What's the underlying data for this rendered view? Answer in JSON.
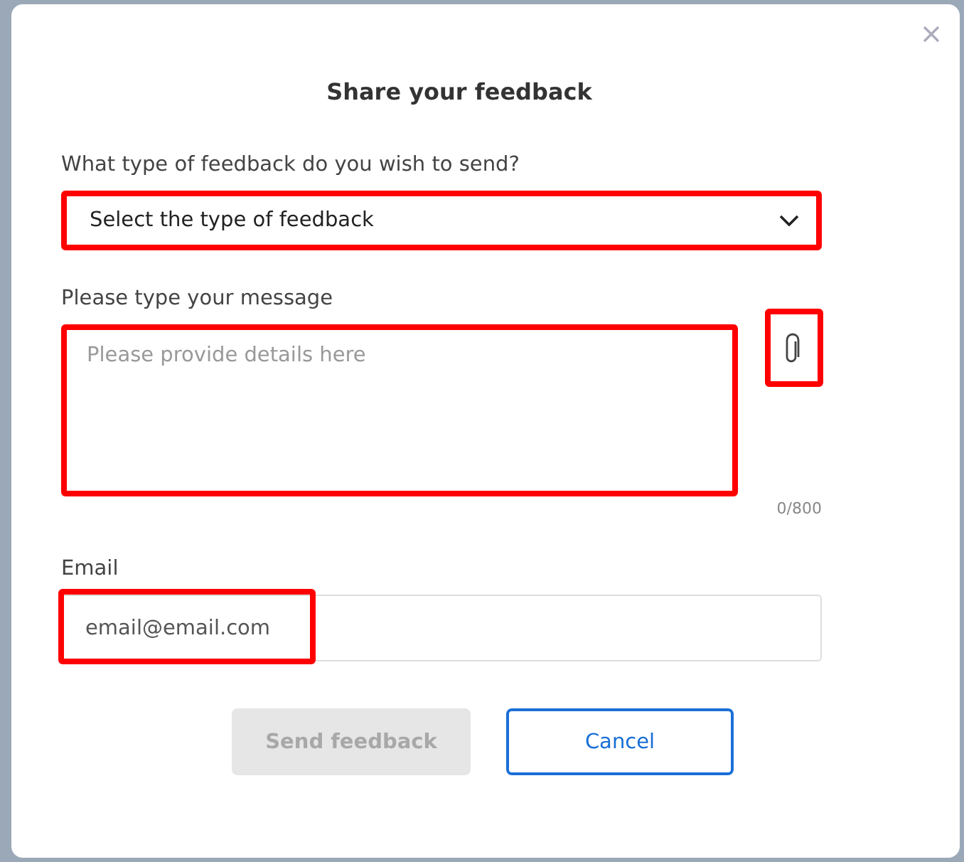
{
  "dialog": {
    "title": "Share your feedback"
  },
  "feedback_type": {
    "label": "What type of feedback do you wish to send?",
    "placeholder": "Select the type of feedback",
    "highlighted": true
  },
  "message": {
    "label": "Please type your message",
    "placeholder": "Please provide details here",
    "counter": "0/800",
    "highlighted": true
  },
  "attach": {
    "highlighted": true
  },
  "email": {
    "label": "Email",
    "value": "email@email.com",
    "highlighted": true
  },
  "buttons": [
    {
      "label": "Send feedback",
      "kind": "primary",
      "disabled": true
    },
    {
      "label": "Cancel",
      "kind": "secondary",
      "disabled": false
    }
  ]
}
